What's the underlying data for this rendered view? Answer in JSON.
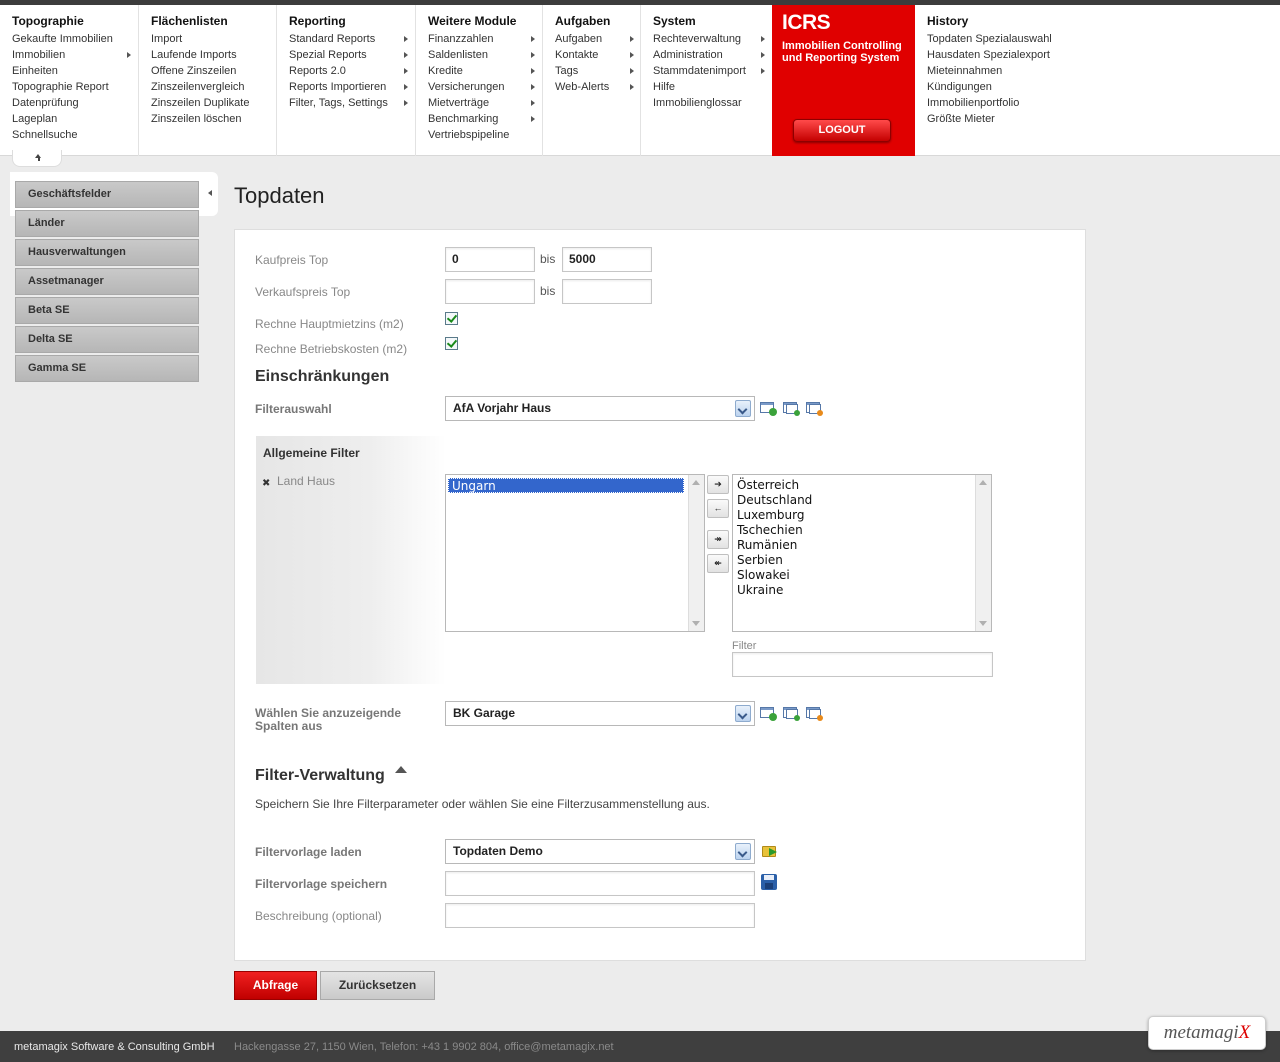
{
  "nav": {
    "columns": [
      {
        "title": "Topographie",
        "items": [
          {
            "label": "Gekaufte Immobilien",
            "arrow": false
          },
          {
            "label": "Immobilien",
            "arrow": true
          },
          {
            "label": "Einheiten",
            "arrow": false
          },
          {
            "label": "Topographie Report",
            "arrow": false
          },
          {
            "label": "Datenprüfung",
            "arrow": false
          },
          {
            "label": "Lageplan",
            "arrow": false
          },
          {
            "label": "Schnellsuche",
            "arrow": false
          }
        ]
      },
      {
        "title": "Flächenlisten",
        "items": [
          {
            "label": "Import",
            "arrow": false
          },
          {
            "label": "Laufende Imports",
            "arrow": false
          },
          {
            "label": "Offene Zinszeilen",
            "arrow": false
          },
          {
            "label": "Zinszeilenvergleich",
            "arrow": false
          },
          {
            "label": "Zinszeilen Duplikate",
            "arrow": false
          },
          {
            "label": "Zinszeilen löschen",
            "arrow": false
          }
        ]
      },
      {
        "title": "Reporting",
        "items": [
          {
            "label": "Standard Reports",
            "arrow": true
          },
          {
            "label": "Spezial Reports",
            "arrow": true
          },
          {
            "label": "Reports 2.0",
            "arrow": true
          },
          {
            "label": "Reports Importieren",
            "arrow": true
          },
          {
            "label": "Filter, Tags, Settings",
            "arrow": true
          }
        ]
      },
      {
        "title": "Weitere Module",
        "items": [
          {
            "label": "Finanzzahlen",
            "arrow": true
          },
          {
            "label": "Saldenlisten",
            "arrow": true
          },
          {
            "label": "Kredite",
            "arrow": true
          },
          {
            "label": "Versicherungen",
            "arrow": true
          },
          {
            "label": "Mietverträge",
            "arrow": true
          },
          {
            "label": "Benchmarking",
            "arrow": true
          },
          {
            "label": "Vertriebspipeline",
            "arrow": false
          }
        ]
      },
      {
        "title": "Aufgaben",
        "items": [
          {
            "label": "Aufgaben",
            "arrow": true
          },
          {
            "label": "Kontakte",
            "arrow": true
          },
          {
            "label": "Tags",
            "arrow": true
          },
          {
            "label": "Web-Alerts",
            "arrow": true
          }
        ]
      },
      {
        "title": "System",
        "items": [
          {
            "label": "Rechteverwaltung",
            "arrow": true
          },
          {
            "label": "Administration",
            "arrow": true
          },
          {
            "label": "Stammdatenimport",
            "arrow": true
          },
          {
            "label": "Hilfe",
            "arrow": false
          },
          {
            "label": "Immobilienglossar",
            "arrow": false
          }
        ]
      },
      {
        "title": "History",
        "items": [
          {
            "label": "Topdaten Spezialauswahl",
            "arrow": false
          },
          {
            "label": "Hausdaten Spezialexport",
            "arrow": false
          },
          {
            "label": "Mieteinnahmen",
            "arrow": false
          },
          {
            "label": "Kündigungen",
            "arrow": false
          },
          {
            "label": "Immobilienportfolio",
            "arrow": false
          },
          {
            "label": "Größte Mieter",
            "arrow": false
          }
        ]
      }
    ],
    "brand": {
      "logo": "ICRS",
      "subtitle": "Immobilien Controlling und Reporting System",
      "logout_label": "LOGOUT",
      "color": "#e00000"
    }
  },
  "sidebar": {
    "items": [
      "Geschäftsfelder",
      "Länder",
      "Hausverwaltungen",
      "Assetmanager",
      "Beta SE",
      "Delta SE",
      "Gamma SE"
    ]
  },
  "page": {
    "title": "Topdaten"
  },
  "form": {
    "kaufpreis": {
      "label": "Kaufpreis Top",
      "from": "0",
      "to": "5000",
      "bis": "bis"
    },
    "verkaufspreis": {
      "label": "Verkaufspreis Top",
      "from": "",
      "to": "",
      "bis": "bis"
    },
    "hauptmietzins": {
      "label": "Rechne Hauptmietzins (m2)",
      "checked": true
    },
    "betriebskosten": {
      "label": "Rechne Betriebskosten (m2)",
      "checked": true
    },
    "einschraenkungen_heading": "Einschränkungen",
    "filterauswahl": {
      "label": "Filterauswahl",
      "value": "AfA Vorjahr Haus"
    },
    "allgemeine_filter": {
      "heading": "Allgemeine Filter",
      "filter_name": "Land Haus",
      "remove_icon": "close-icon",
      "selected": [
        "Ungarn"
      ],
      "available": [
        "Österreich",
        "Deutschland",
        "Luxemburg",
        "Tschechien",
        "Rumänien",
        "Serbien",
        "Slowakei",
        "Ukraine"
      ],
      "filter_label": "Filter",
      "filter_value": ""
    },
    "spalten": {
      "label": "Wählen Sie anzuzeigende Spalten aus",
      "value": "BK Garage"
    },
    "verwaltung": {
      "heading": "Filter-Verwaltung",
      "description": "Speichern Sie Ihre Filterparameter oder wählen Sie eine Filterzusammenstellung aus.",
      "laden_label": "Filtervorlage laden",
      "laden_value": "Topdaten Demo",
      "speichern_label": "Filtervorlage speichern",
      "speichern_value": "",
      "beschreibung_label": "Beschreibung (optional)",
      "beschreibung_value": ""
    },
    "buttons": {
      "submit": "Abfrage",
      "reset": "Zurücksetzen"
    }
  },
  "footer": {
    "company": "metamagix Software & Consulting GmbH",
    "address": "Hackengasse 27, 1150 Wien, Telefon: +43 1 9902 804, office@metamagix.net",
    "logo_main": "metamagi",
    "logo_x": "X"
  }
}
